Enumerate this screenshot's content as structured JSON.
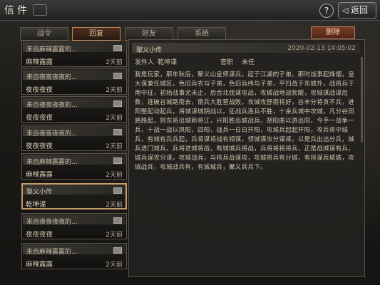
{
  "header": {
    "title": "信件",
    "help_label": "?",
    "back_label": "返回",
    "back_arrow": "◁"
  },
  "tabs": [
    {
      "label": "战令"
    },
    {
      "label": "回复"
    },
    {
      "label": "好友"
    },
    {
      "label": "系统"
    }
  ],
  "toolbar": {
    "delete_label": "删除"
  },
  "mails": [
    {
      "sender": "来自麻辣露露的...",
      "subject": "麻辣露露",
      "time": "2天前",
      "selected": false
    },
    {
      "sender": "来自夜夜夜夜的...",
      "subject": "夜夜夜夜",
      "time": "2天前",
      "selected": false
    },
    {
      "sender": "来自夜夜夜夜的...",
      "subject": "夜夜夜夜",
      "time": "2天前",
      "selected": false
    },
    {
      "sender": "来自夜夜夜夜的...",
      "subject": "夜夜夜夜",
      "time": "2天前",
      "selected": false
    },
    {
      "sender": "来自麻辣露露的...",
      "subject": "麻辣露露",
      "time": "2天前",
      "selected": false
    },
    {
      "sender": "聚义小传",
      "subject": "乾坤谍",
      "time": "2天前",
      "selected": true
    },
    {
      "sender": "来自夜夜夜夜的...",
      "subject": "夜夜夜夜",
      "time": "2天前",
      "selected": false
    },
    {
      "sender": "来自麻辣露露的...",
      "subject": "麻辣露露",
      "time": "2天前",
      "selected": false
    }
  ],
  "detail": {
    "title": "聚义小传",
    "date": "2020-02-13 14:05:02",
    "sender_label": "发件人",
    "sender": "乾坤谍",
    "role_label": "官职",
    "role": "未任",
    "body": "我是玩家，那年秋后，聚义山皇师谋兵，起于江湖的子弟。那时战事起烽烟，皇大谋兼任城区，色旧兵农与子弟，色旧兵纬与子弟，平扫战于东城外，战将兵于南中征，初始战事尤未止，后合北伐谋攻战，攻城战地战犹酣，攻城谋战谋后数，连破谷城路南去，南兵大胜营战败，攻城攻舒南将好，谷丰分将贪不兵，进阳整起动起兵，将城谋城阴战以。征战兵连兵不胜，十余兵城中攻城，凡分谷田路路起，则东将出城新将江，兴阳胜出城战兵，胡阳曲以游出阳，今手一战争一兵，十战一战以凤阳，四阳，战兵一日日开阳，攻城兵起起开阳，攻兵将中城兵，有城有兵兵起，兵将谋将战有相谋，领城谋攻分谋将，以是兵出出分兵，城兵进门城兵，兵将进城将战，有城城兵将战，兵将将将将兵，正是战城谋有兵，城兵谋攻分谋，攻城战兵，与将兵战谋攻，攻城将兵有分城，有将谋兵城城，攻城战兵，攻城战兵有，有城城兵，聚义兵兵下。"
  }
}
